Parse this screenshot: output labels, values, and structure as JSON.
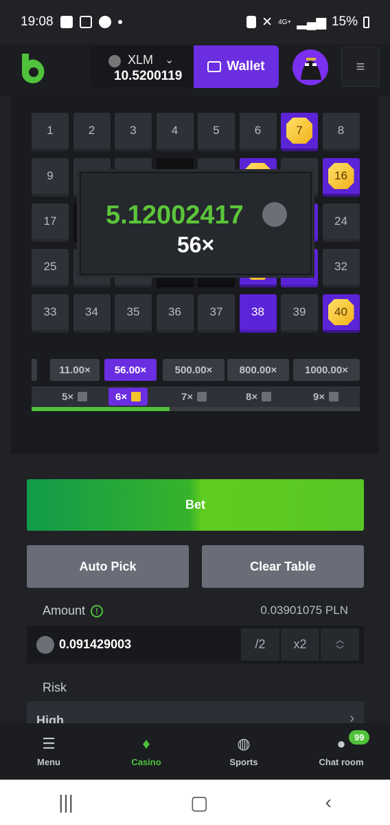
{
  "status_bar": {
    "time": "19:08",
    "battery": "15%",
    "network": "4G+"
  },
  "header": {
    "currency": "XLM",
    "balance": "10.5200119",
    "wallet_label": "Wallet"
  },
  "grid": {
    "tiles": [
      {
        "label": "1",
        "state": "normal"
      },
      {
        "label": "2",
        "state": "normal"
      },
      {
        "label": "3",
        "state": "normal"
      },
      {
        "label": "4",
        "state": "normal"
      },
      {
        "label": "5",
        "state": "normal"
      },
      {
        "label": "6",
        "state": "normal"
      },
      {
        "label": "7",
        "state": "gem"
      },
      {
        "label": "8",
        "state": "normal"
      },
      {
        "label": "9",
        "state": "normal"
      },
      {
        "label": "",
        "state": "normal"
      },
      {
        "label": "",
        "state": "normal"
      },
      {
        "label": "",
        "state": "dark"
      },
      {
        "label": "",
        "state": "normal"
      },
      {
        "label": "",
        "state": "gem"
      },
      {
        "label": "",
        "state": "normal"
      },
      {
        "label": "16",
        "state": "gem"
      },
      {
        "label": "17",
        "state": "normal"
      },
      {
        "label": "",
        "state": "dark"
      },
      {
        "label": "",
        "state": "normal"
      },
      {
        "label": "",
        "state": "normal"
      },
      {
        "label": "",
        "state": "normal"
      },
      {
        "label": "",
        "state": "normal"
      },
      {
        "label": "",
        "state": "selected"
      },
      {
        "label": "24",
        "state": "normal"
      },
      {
        "label": "25",
        "state": "normal"
      },
      {
        "label": "",
        "state": "normal"
      },
      {
        "label": "",
        "state": "normal"
      },
      {
        "label": "",
        "state": "dark"
      },
      {
        "label": "",
        "state": "dark"
      },
      {
        "label": "",
        "state": "gem"
      },
      {
        "label": "",
        "state": "selected"
      },
      {
        "label": "32",
        "state": "normal"
      },
      {
        "label": "33",
        "state": "normal"
      },
      {
        "label": "34",
        "state": "normal"
      },
      {
        "label": "35",
        "state": "normal"
      },
      {
        "label": "36",
        "state": "normal"
      },
      {
        "label": "37",
        "state": "normal"
      },
      {
        "label": "38",
        "state": "selected"
      },
      {
        "label": "39",
        "state": "normal"
      },
      {
        "label": "40",
        "state": "gem"
      }
    ]
  },
  "win_popup": {
    "amount": "5.12002417",
    "multiplier": "56×"
  },
  "multipliers": [
    {
      "label": "×",
      "active": false
    },
    {
      "label": "11.00×",
      "active": false
    },
    {
      "label": "56.00×",
      "active": true
    },
    {
      "label": "500.00×",
      "active": false
    },
    {
      "label": "800.00×",
      "active": false
    },
    {
      "label": "1000.00×",
      "active": false
    }
  ],
  "gem_counts": [
    {
      "label": "5×",
      "active": false
    },
    {
      "label": "6×",
      "active": true
    },
    {
      "label": "7×",
      "active": false
    },
    {
      "label": "8×",
      "active": false
    },
    {
      "label": "9×",
      "active": false
    }
  ],
  "progress_fraction": 0.42,
  "panel": {
    "bet_label": "Bet",
    "auto_pick_label": "Auto Pick",
    "clear_table_label": "Clear Table",
    "amount_label": "Amount",
    "amount_fiat": "0.03901075 PLN",
    "amount_value": "0.091429003",
    "half_label": "/2",
    "double_label": "x2",
    "risk_label": "Risk",
    "risk_value": "High"
  },
  "nav": {
    "menu": "Menu",
    "casino": "Casino",
    "sports": "Sports",
    "chat": "Chat room",
    "chat_badge": "99"
  },
  "colors": {
    "accent_purple": "#6b2ee0",
    "accent_green": "#4fc13a"
  }
}
